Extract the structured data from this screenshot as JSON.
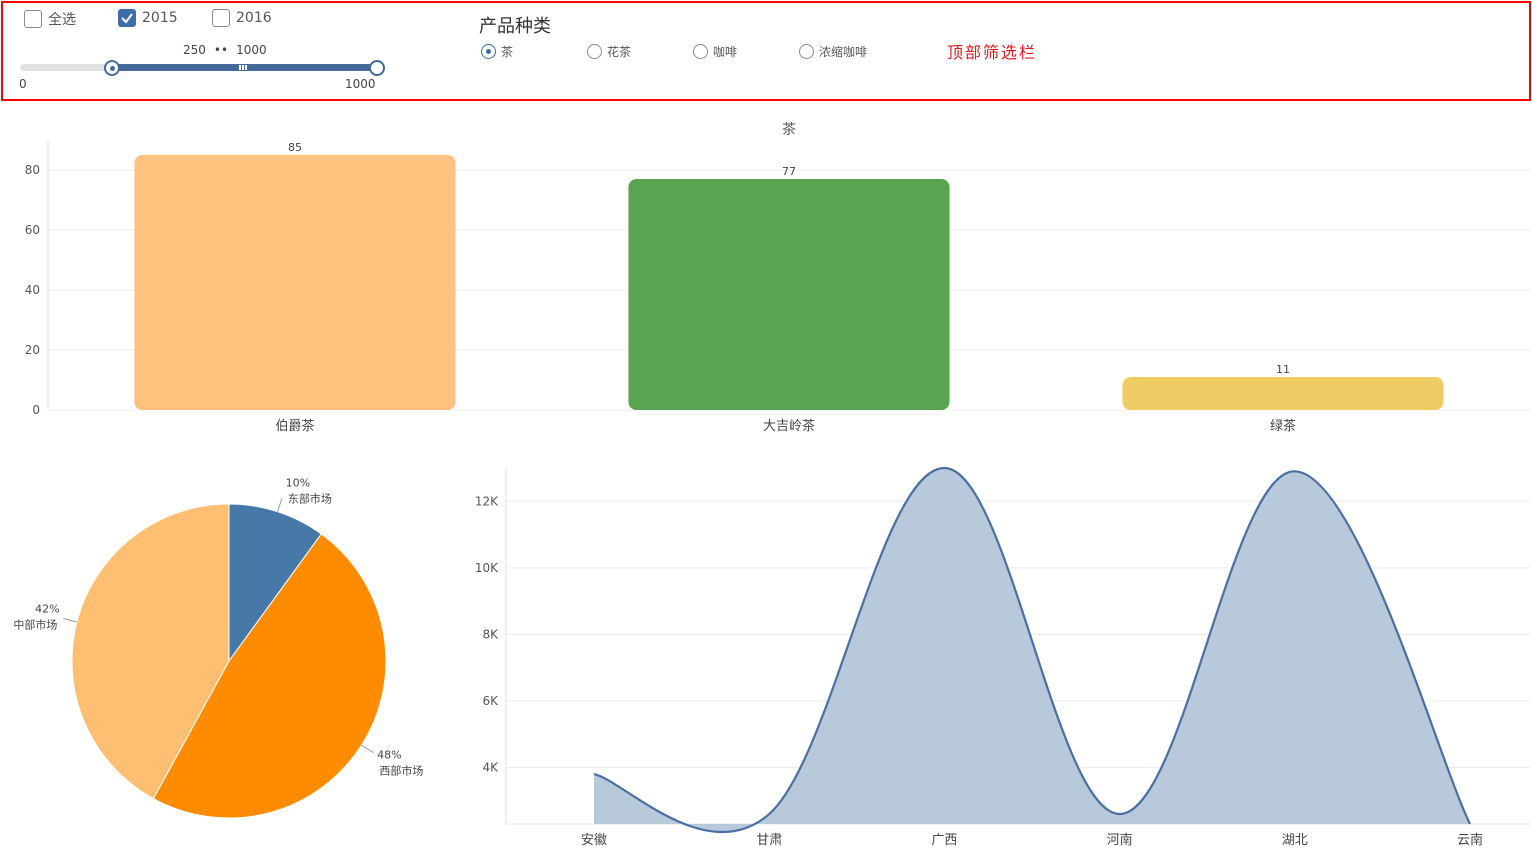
{
  "filters": {
    "checkboxes": [
      {
        "label": "全选",
        "checked": false
      },
      {
        "label": "2015",
        "checked": true
      },
      {
        "label": "2016",
        "checked": false
      }
    ],
    "range": {
      "min": 0,
      "max": 1000,
      "low": 250,
      "high": 1000,
      "min_label": "0",
      "max_label": "1000",
      "low_label": "250",
      "high_label": "1000",
      "separator": "••"
    },
    "category_title": "产品种类",
    "categories": [
      {
        "label": "茶",
        "checked": true
      },
      {
        "label": "花茶",
        "checked": false
      },
      {
        "label": "咖啡",
        "checked": false
      },
      {
        "label": "浓缩咖啡",
        "checked": false
      }
    ],
    "annotation": "顶部筛选栏"
  },
  "chart_data": [
    {
      "type": "bar",
      "title": "茶",
      "categories": [
        "伯爵茶",
        "大吉岭茶",
        "绿茶"
      ],
      "values": [
        85,
        77,
        11
      ],
      "colors": [
        "#ffc17d",
        "#5aa350",
        "#f0cc64"
      ],
      "ylim": [
        0,
        90
      ],
      "yticks": [
        0,
        20,
        40,
        60,
        80
      ],
      "xlabel": "",
      "ylabel": "",
      "grid": true,
      "data_labels": true
    },
    {
      "type": "pie",
      "slices": [
        {
          "label": "东部市场",
          "percent": 10,
          "color": "#4678a8"
        },
        {
          "label": "西部市场",
          "percent": 48,
          "color": "#ff8c00"
        },
        {
          "label": "中部市场",
          "percent": 42,
          "color": "#ffbf73"
        }
      ]
    },
    {
      "type": "area",
      "categories": [
        "安徽",
        "甘肃",
        "广西",
        "河南",
        "湖北",
        "云南"
      ],
      "values": [
        3800,
        2600,
        13000,
        2600,
        12900,
        2300
      ],
      "ylim": [
        2300,
        13000
      ],
      "yticks": [
        4000,
        6000,
        8000,
        10000,
        12000
      ],
      "ytick_labels": [
        "4K",
        "6K",
        "8K",
        "10K",
        "12K"
      ],
      "line_color": "#4a6fa0",
      "fill_color": "#b8c9dc",
      "grid": true
    }
  ]
}
